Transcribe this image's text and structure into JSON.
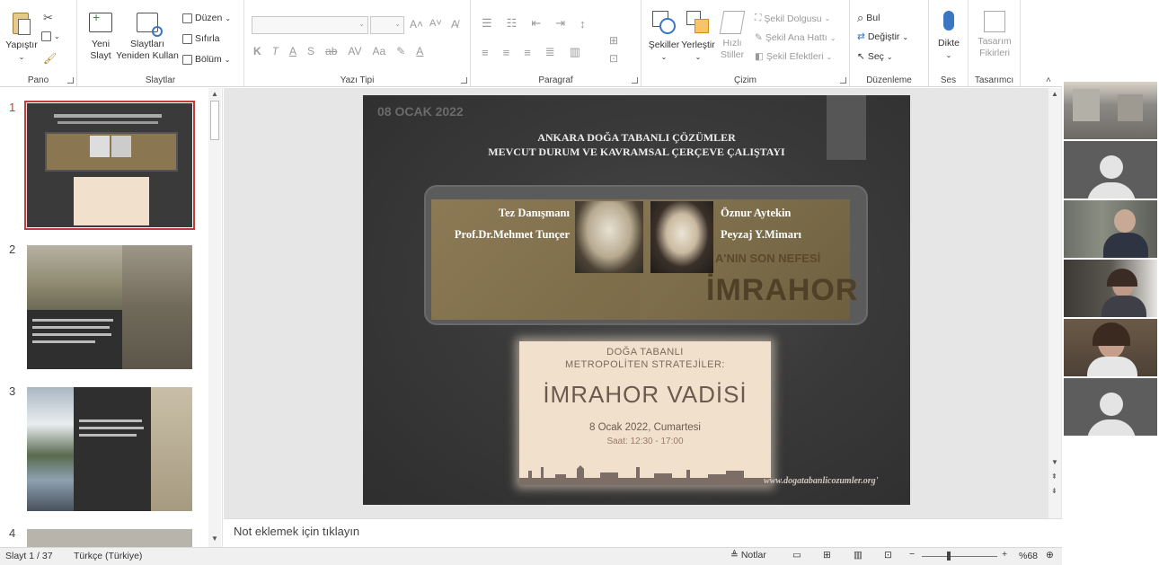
{
  "ribbon": {
    "pano": {
      "paste": "Yapıştır",
      "label": "Pano"
    },
    "slaytlar": {
      "new_slide": "Yeni\nSlayt",
      "reuse": "Slaytları\nYeniden Kullan",
      "layout": "Düzen",
      "reset": "Sıfırla",
      "section": "Bölüm",
      "label": "Slaytlar"
    },
    "yazi_tipi": {
      "label": "Yazı Tipi",
      "bold": "K",
      "italic": "T",
      "underline": "A",
      "shadow": "S",
      "strike": "ab",
      "spacing": "AV",
      "case": "Aa"
    },
    "paragraf": {
      "label": "Paragraf"
    },
    "cizim": {
      "shapes": "Şekiller",
      "arrange": "Yerleştir",
      "quick_styles": "Hızlı\nStiller",
      "fill": "Şekil Dolgusu",
      "outline": "Şekil Ana Hattı",
      "effects": "Şekil Efektleri",
      "label": "Çizim"
    },
    "duzenleme": {
      "find": "Bul",
      "replace": "Değiştir",
      "select": "Seç",
      "label": "Düzenleme"
    },
    "ses": {
      "dictate": "Dikte",
      "label": "Ses"
    },
    "tasarimci": {
      "ideas": "Tasarım\nFikirleri",
      "label": "Tasarımcı"
    }
  },
  "thumbnails": {
    "items": [
      {
        "num": "1"
      },
      {
        "num": "2"
      },
      {
        "num": "3"
      },
      {
        "num": "4"
      }
    ]
  },
  "slide": {
    "date": "08 OCAK 2022",
    "title1": "ANKARA DOĞA TABANLI ÇÖZÜMLER",
    "title2": "MEVCUT DURUM VE KAVRAMSAL ÇERÇEVE ÇALIŞTAYI",
    "advisor_role": "Tez Danışmanı",
    "advisor_name": "Prof.Dr.Mehmet Tunçer",
    "author_name": "Öznur Aytekin",
    "author_role": "Peyzaj Y.Mimarı",
    "banner_sub": "A'NIN SON NEFESİ",
    "banner_main": "İMRAHOR",
    "poster_line1": "DOĞA TABANLI",
    "poster_line2": "METROPOLİTEN STRATEJİLER:",
    "poster_title": "İMRAHOR VADİSİ",
    "poster_date": "8 Ocak 2022, Cumartesi",
    "poster_time": "Saat: 12:30 - 17:00",
    "url": "www.dogatabanlicozumler.org'"
  },
  "notes": {
    "placeholder": "Not eklemek için tıklayın"
  },
  "status": {
    "slide": "Slayt 1 / 37",
    "language": "Türkçe (Türkiye)",
    "notes": "Notlar",
    "zoom": "%68"
  },
  "colors": {
    "accent": "#c43b3b",
    "slide_bg": "#3a3a3a",
    "sepia": "#8a7650",
    "poster_bg": "#f1e1cc"
  }
}
